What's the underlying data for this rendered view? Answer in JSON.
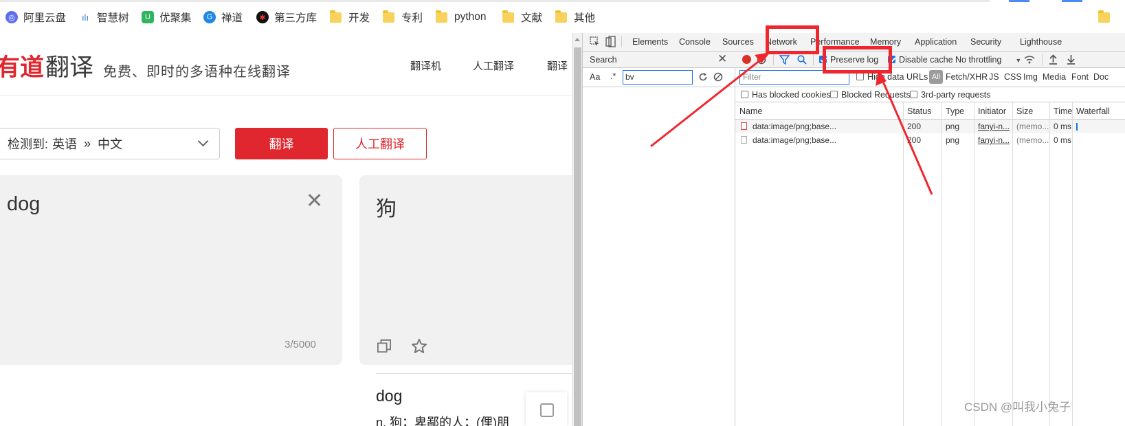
{
  "bookmarks": [
    {
      "label": "阿里云盘",
      "icon": "aliyun-drive-icon"
    },
    {
      "label": "智慧树",
      "icon": "zhihuishu-icon"
    },
    {
      "label": "优聚集",
      "icon": "youjuji-icon"
    },
    {
      "label": "禅道",
      "icon": "zentao-icon"
    },
    {
      "label": "第三方库",
      "icon": "third-party-lib-icon"
    },
    {
      "label": "开发",
      "icon": "folder-icon"
    },
    {
      "label": "专利",
      "icon": "folder-icon"
    },
    {
      "label": "python",
      "icon": "folder-icon"
    },
    {
      "label": "文献",
      "icon": "folder-icon"
    },
    {
      "label": "其他",
      "icon": "folder-icon"
    }
  ],
  "page": {
    "logo_red": "有道",
    "logo_dark": "翻译",
    "slogan": "免费、即时的多语种在线翻译",
    "nav": [
      "翻译机",
      "人工翻译",
      "翻译"
    ],
    "lang_prefix": "检测到:",
    "lang_from": "英语",
    "lang_sep": "»",
    "lang_to": "中文",
    "translate_btn": "翻译",
    "human_btn": "人工翻译",
    "source_text": "dog",
    "char_count": "3/5000",
    "target_text": "狗",
    "dict_word": "dog",
    "dict_def": "n. 狗；卑鄙的人；(俚)朋"
  },
  "devtools": {
    "tabs": [
      "Elements",
      "Console",
      "Sources",
      "Network",
      "Performance",
      "Memory",
      "Application",
      "Security",
      "Lighthouse"
    ],
    "active_tab": "Network",
    "search_title": "Search",
    "search_aa": "Aa",
    "search_regex": ".*",
    "search_value": "bv",
    "preserve_log": "Preserve log",
    "disable_cache": "Disable cache",
    "throttling": "No throttling",
    "filter_placeholder": "Filter",
    "hide_data_urls": "Hide data URLs",
    "all": "All",
    "types": [
      "Fetch/XHR",
      "JS",
      "CSS",
      "Img",
      "Media",
      "Font",
      "Doc"
    ],
    "has_blocked_cookies": "Has blocked cookies",
    "blocked_requests": "Blocked Requests",
    "third_party": "3rd-party requests",
    "columns": [
      "Name",
      "Status",
      "Type",
      "Initiator",
      "Size",
      "Time",
      "Waterfall"
    ],
    "rows": [
      {
        "name": "data:image/png;base...",
        "status": "200",
        "type": "png",
        "initiator": "fanyi-n...",
        "size": "(memo...",
        "time": "0 ms"
      },
      {
        "name": "data:image/png;base...",
        "status": "200",
        "type": "png",
        "initiator": "fanyi-n...",
        "size": "(memo...",
        "time": "0 ms"
      }
    ]
  },
  "watermark": "CSDN @叫我小兔子",
  "colors": {
    "brand_red": "#e0262f",
    "annotation_red": "#f0262f",
    "devtools_blue": "#1a73e8"
  }
}
